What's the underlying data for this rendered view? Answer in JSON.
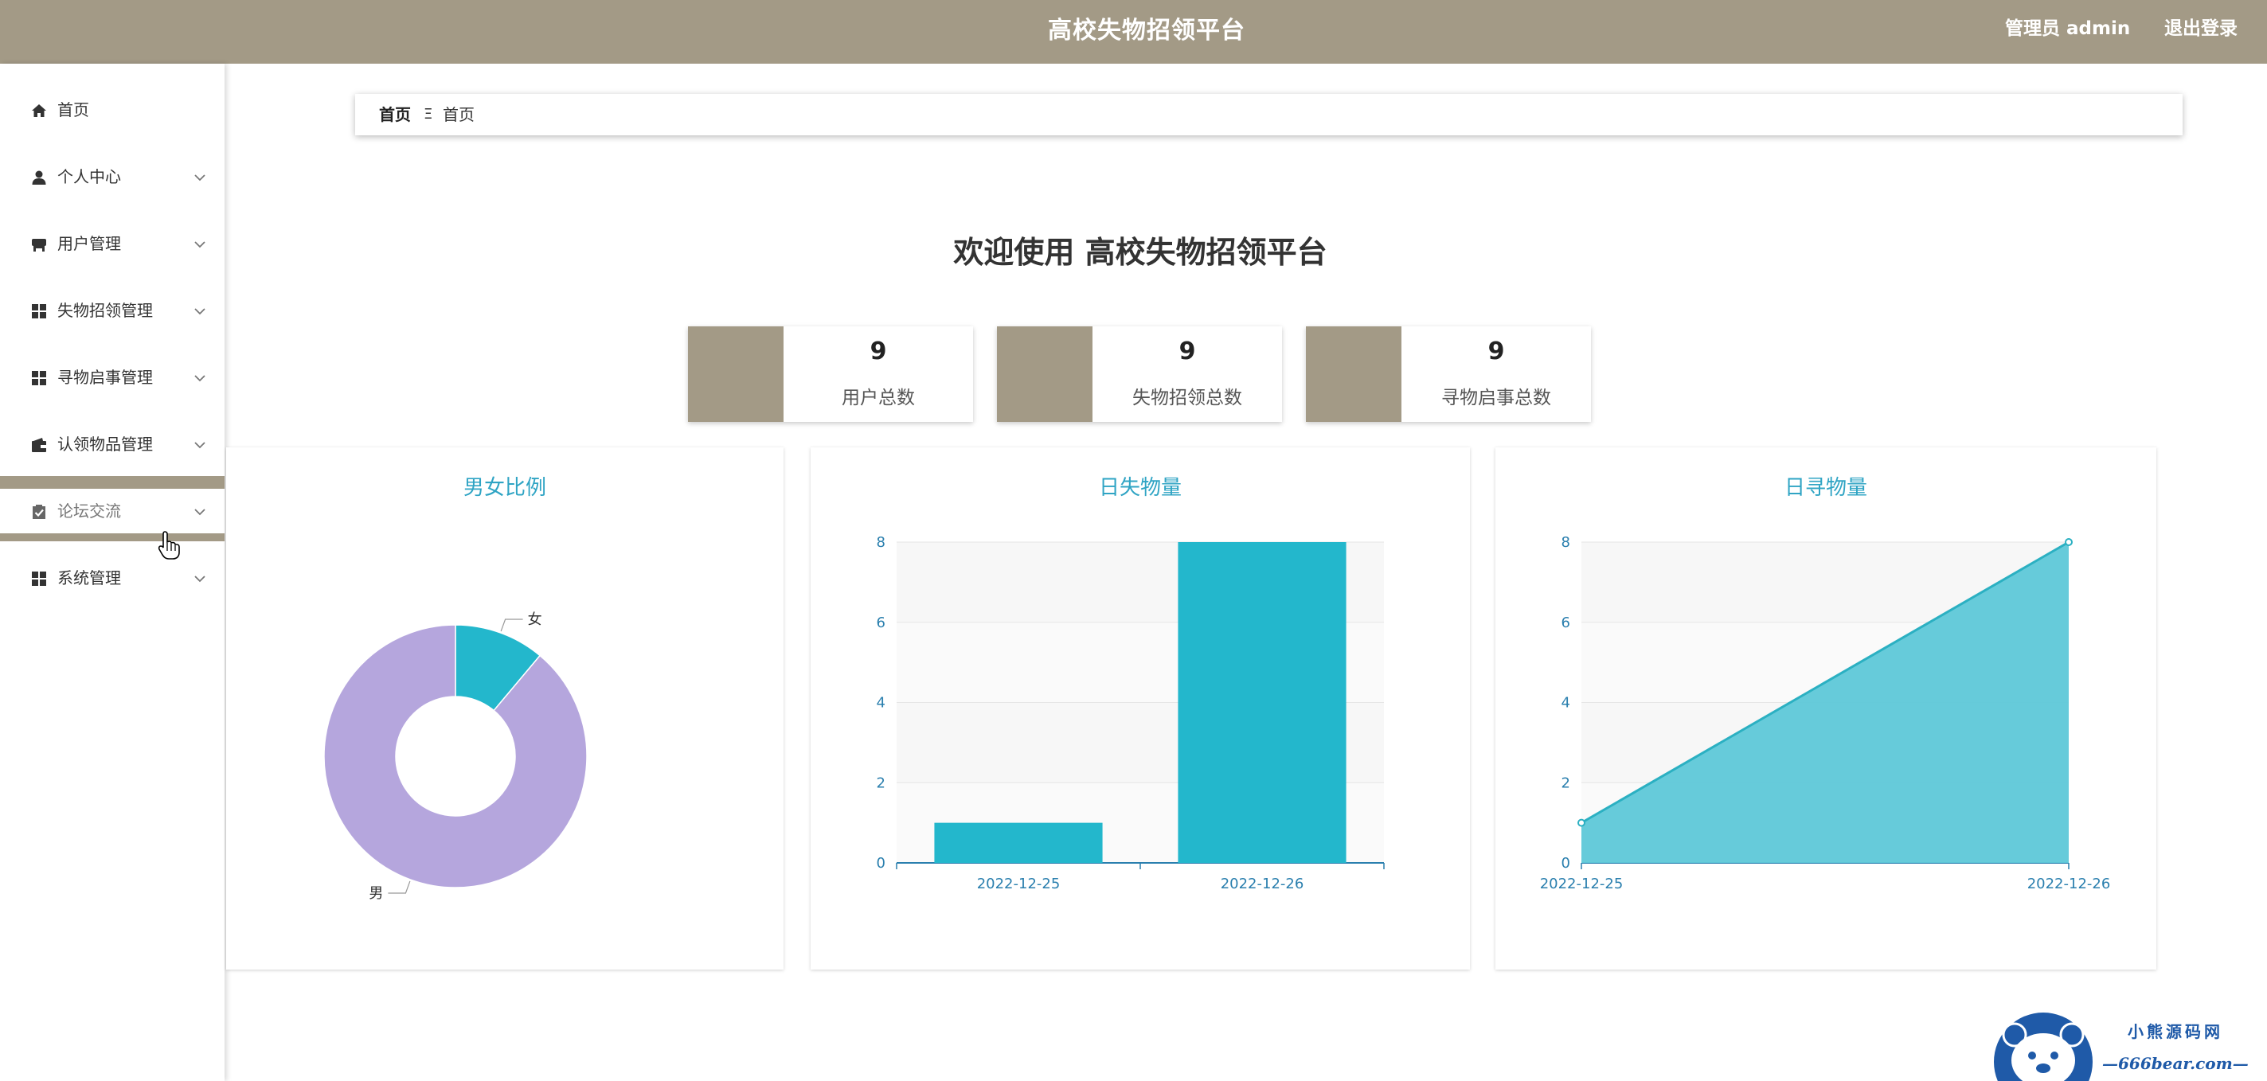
{
  "header": {
    "title": "高校失物招领平台",
    "user_label": "管理员 admin",
    "logout_label": "退出登录",
    "bg_color": "#a39a86"
  },
  "sidebar": {
    "items": [
      {
        "label": "首页",
        "icon": "home-icon",
        "has_submenu": false
      },
      {
        "label": "个人中心",
        "icon": "person-icon",
        "has_submenu": true
      },
      {
        "label": "用户管理",
        "icon": "desk-icon",
        "has_submenu": true
      },
      {
        "label": "失物招领管理",
        "icon": "grid-icon",
        "has_submenu": true
      },
      {
        "label": "寻物启事管理",
        "icon": "grid-icon",
        "has_submenu": true
      },
      {
        "label": "认领物品管理",
        "icon": "wallet-icon",
        "has_submenu": true
      },
      {
        "label": "论坛交流",
        "icon": "clipboard-check-icon",
        "has_submenu": true,
        "hovered": true
      },
      {
        "label": "系统管理",
        "icon": "grid-icon",
        "has_submenu": true
      }
    ]
  },
  "breadcrumb": {
    "home": "首页",
    "separator": "Ξ",
    "current": "首页"
  },
  "welcome": "欢迎使用 高校失物招领平台",
  "stats": [
    {
      "value": "9",
      "label": "用户总数"
    },
    {
      "value": "9",
      "label": "失物招领总数"
    },
    {
      "value": "9",
      "label": "寻物启事总数"
    }
  ],
  "chart_data": [
    {
      "type": "pie",
      "title": "男女比例",
      "donut": true,
      "categories": [
        "女",
        "男"
      ],
      "values": [
        1,
        8
      ],
      "colors": [
        "#23b7cc",
        "#b5a6dd"
      ]
    },
    {
      "type": "bar",
      "title": "日失物量",
      "categories": [
        "2022-12-25",
        "2022-12-26"
      ],
      "values": [
        1,
        8
      ],
      "ylim": [
        0,
        8
      ],
      "yticks": [
        "0",
        "2",
        "4",
        "6",
        "8"
      ],
      "color": "#23b7cc",
      "grid": true
    },
    {
      "type": "area",
      "title": "日寻物量",
      "categories": [
        "2022-12-25",
        "2022-12-26"
      ],
      "values": [
        1,
        8
      ],
      "ylim": [
        0,
        8
      ],
      "yticks": [
        "0",
        "2",
        "4",
        "6",
        "8"
      ],
      "color": "#5ec8d8",
      "grid": true
    }
  ],
  "watermark": {
    "line1": "小熊源码网",
    "line2": "—666bear.com—"
  }
}
